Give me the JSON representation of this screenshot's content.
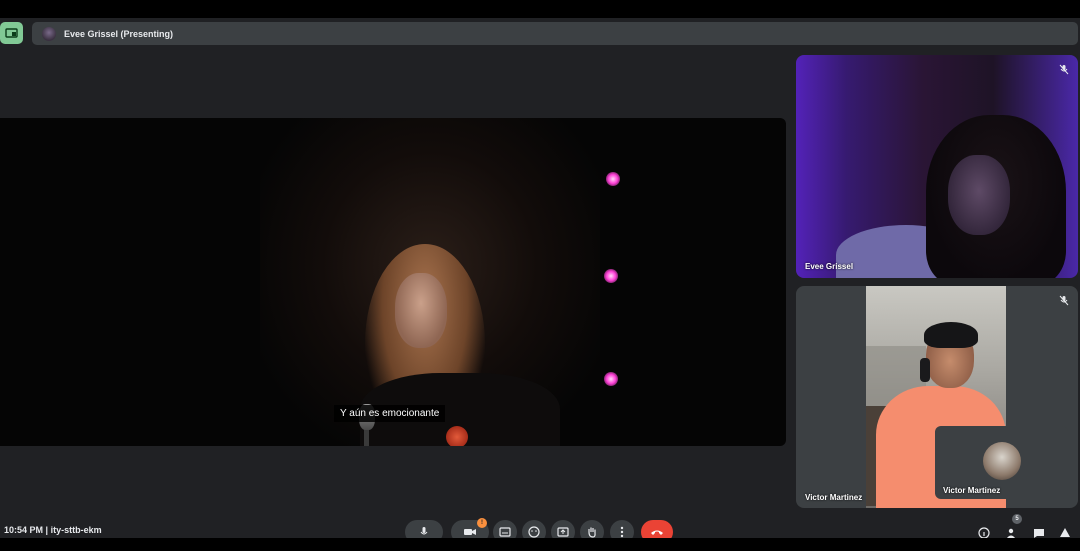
{
  "presenting_bar": {
    "label": "Evee Grissel (Presenting)"
  },
  "stage": {
    "subtitle": "Y aún es emocionante"
  },
  "participants": [
    {
      "name": "Evee Grissel",
      "muted": true
    },
    {
      "name": "Victor Martinez",
      "muted": true
    }
  ],
  "self_view": {
    "name": "Victor Martinez"
  },
  "bottom": {
    "clock": "10:54 PM",
    "meeting_code": "ity-sttb-ekm",
    "people_count": "5",
    "reactions_badge": "!"
  },
  "colors": {
    "accent_green": "#81c995",
    "end_call_red": "#ea4335",
    "surface": "#3c4043",
    "background": "#202124"
  }
}
